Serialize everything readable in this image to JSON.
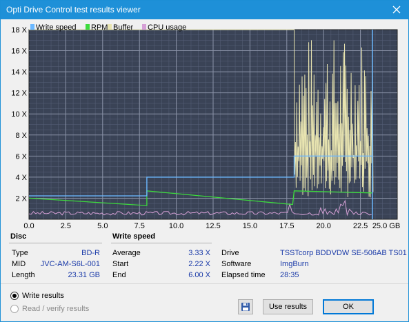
{
  "window": {
    "title": "Opti Drive Control test results viewer"
  },
  "chart_data": {
    "type": "line",
    "legend": [
      "Write speed",
      "RPM",
      "Buffer",
      "CPU usage"
    ],
    "legend_colors": [
      "#6bb8ff",
      "#3ddc3d",
      "#e8e4b0",
      "#d6a0d6"
    ],
    "y_ticks": [
      "2 X",
      "4 X",
      "6 X",
      "8 X",
      "10 X",
      "12 X",
      "14 X",
      "16 X",
      "18 X"
    ],
    "x_ticks": [
      "0.0",
      "2.5",
      "5.0",
      "7.5",
      "10.0",
      "12.5",
      "15.0",
      "17.5",
      "20.0",
      "22.5",
      "25.0 GB"
    ],
    "xlim": [
      0,
      25
    ],
    "ylim": [
      0,
      18
    ],
    "grid": true,
    "background": "#3a4356",
    "series": [
      {
        "name": "Write speed",
        "color": "#6bb8ff",
        "x": [
          0.0,
          8.0,
          8.0,
          18.0,
          18.0,
          23.31
        ],
        "values": [
          2.22,
          2.22,
          4.0,
          4.0,
          6.0,
          6.0
        ]
      },
      {
        "name": "RPM",
        "color": "#3ddc3d",
        "x": [
          0.0,
          8.0,
          8.0,
          17.9,
          18.0,
          23.31
        ],
        "values": [
          2.0,
          1.3,
          2.7,
          1.4,
          2.7,
          2.5
        ]
      },
      {
        "name": "CPU usage",
        "color": "#d6a0d6",
        "x": [
          0.0,
          23.31
        ],
        "values": [
          0.5,
          0.5
        ]
      },
      {
        "name": "Buffer",
        "color": "#e8e4b0",
        "x": [
          0.0,
          18.0,
          18.0,
          23.31
        ],
        "values": [
          18.0,
          18.0,
          6.0,
          6.0
        ]
      }
    ]
  },
  "disc": {
    "heading": "Disc",
    "rows": [
      {
        "label": "Type",
        "value": "BD-R"
      },
      {
        "label": "MID",
        "value": "JVC-AM-S6L-001"
      },
      {
        "label": "Length",
        "value": "23.31 GB"
      }
    ]
  },
  "write_speed": {
    "heading": "Write speed",
    "rows": [
      {
        "label": "Average",
        "value": "3.33 X"
      },
      {
        "label": "Start",
        "value": "2.22 X"
      },
      {
        "label": "End",
        "value": "6.00 X"
      }
    ]
  },
  "info": {
    "rows": [
      {
        "label": "Drive",
        "value": "TSSTcorp  BDDVDW SE-506AB TS01"
      },
      {
        "label": "Software",
        "value": "ImgBurn"
      },
      {
        "label": "Elapsed time",
        "value": "28:35"
      }
    ]
  },
  "options": {
    "write_results": "Write results",
    "read_verify": "Read / verify results"
  },
  "buttons": {
    "save_icon": "floppy-disk-icon",
    "use_results": "Use results",
    "ok": "OK"
  }
}
